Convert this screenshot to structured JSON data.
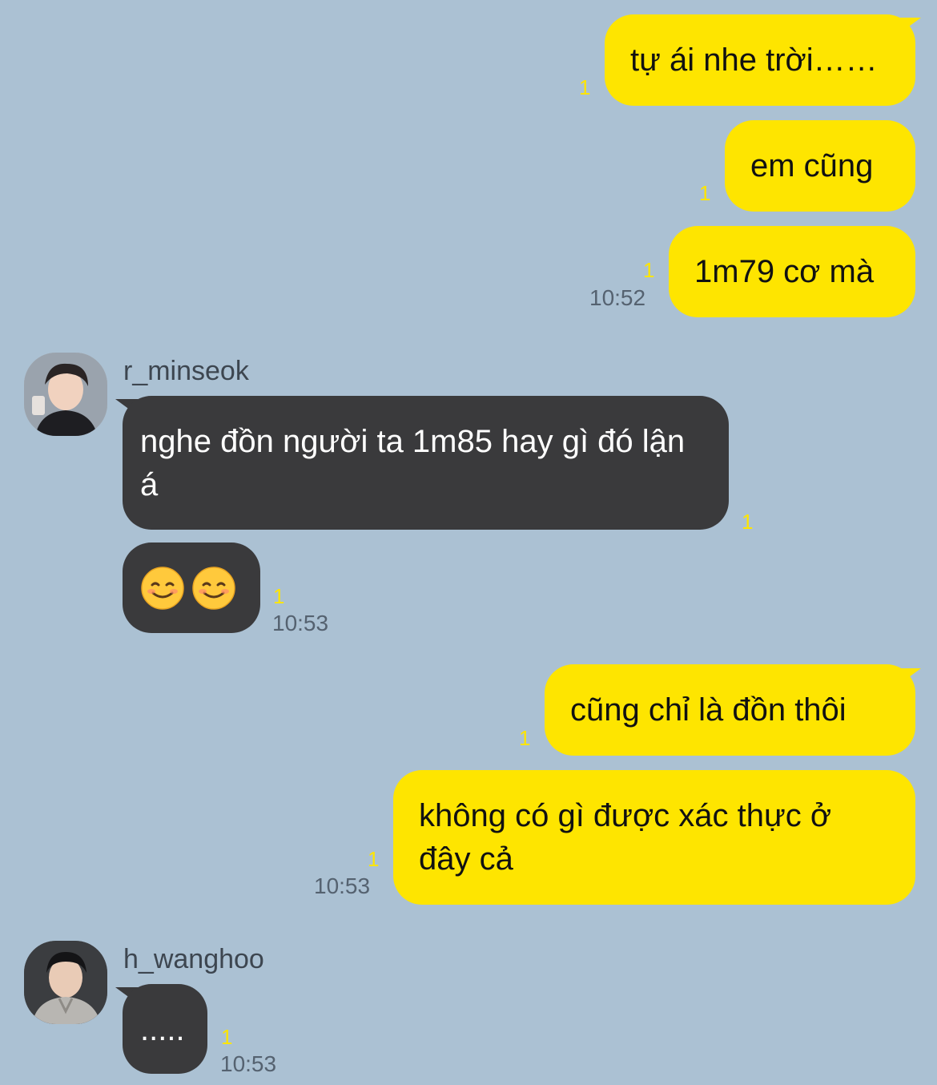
{
  "colors": {
    "background": "#abc1d3",
    "my_bubble": "#fee500",
    "their_bubble": "#3a3a3c",
    "read_count": "#fee500",
    "timestamp": "#556270"
  },
  "messages": [
    {
      "from": "me",
      "text": "tự ái nhe trời……",
      "read": "1"
    },
    {
      "from": "me",
      "text": "em cũng",
      "read": "1"
    },
    {
      "from": "me",
      "text": "1m79 cơ mà",
      "read": "1",
      "time": "10:52"
    },
    {
      "from": "r_minseok",
      "sender": "r_minseok",
      "avatar_icon": "user-avatar-icon",
      "text": "nghe đồn người ta 1m85 hay gì đó lận á",
      "read": "1"
    },
    {
      "from": "r_minseok",
      "emoji": [
        "smiling-face-emoji",
        "smiling-face-emoji"
      ],
      "read": "1",
      "time": "10:53"
    },
    {
      "from": "me",
      "text": "cũng chỉ là đồn thôi",
      "read": "1"
    },
    {
      "from": "me",
      "text": "không có gì được xác thực ở đây cả",
      "read": "1",
      "time": "10:53"
    },
    {
      "from": "h_wanghoo",
      "sender": "h_wanghoo",
      "avatar_icon": "user-avatar-icon",
      "text": ".....",
      "read": "1",
      "time": "10:53"
    }
  ]
}
